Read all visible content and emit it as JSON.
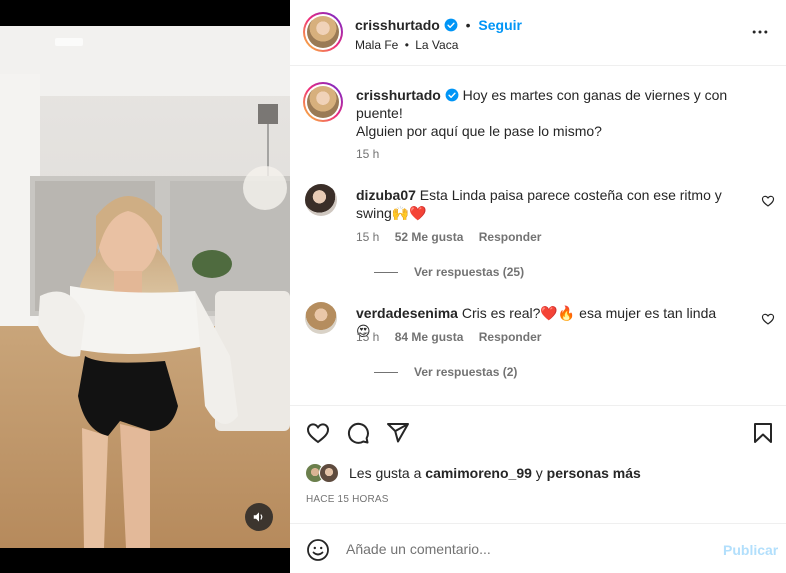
{
  "post": {
    "username": "crisshurtado",
    "follow_label": "Seguir",
    "audio_artist": "Mala Fe",
    "audio_title": "La Vaca",
    "audio_sep": "•",
    "header_sep": "•"
  },
  "caption": {
    "username": "crisshurtado",
    "line1": "Hoy es martes con ganas de viernes y con",
    "line2": "puente!",
    "line3": "Alguien por aquí que le pase lo mismo?",
    "time": "15 h"
  },
  "comments": [
    {
      "username": "dizuba07",
      "text_line1": "Esta Linda paisa parece costeña con ese ritmo y",
      "text_line2": "swing🙌❤️",
      "time": "15 h",
      "likes": "52 Me gusta",
      "reply_label": "Responder",
      "view_replies": "Ver respuestas (25)"
    },
    {
      "username": "verdadesenima",
      "text_line1": "Cris es real?❤️🔥 esa mujer es tan linda 😍",
      "time": "15 h",
      "likes": "84 Me gusta",
      "reply_label": "Responder",
      "view_replies": "Ver respuestas (2)"
    }
  ],
  "likes": {
    "prefix": "Les gusta a",
    "user": "camimoreno_99",
    "conj": "y",
    "others": "personas más"
  },
  "posted_ago": "HACE 15 HORAS",
  "add_comment": {
    "placeholder": "Añade un comentario...",
    "publish_label": "Publicar"
  },
  "icons": {
    "verified": "verified-badge-icon",
    "more": "more-options-icon",
    "like": "heart-icon",
    "comment": "comment-icon",
    "share": "share-icon",
    "save": "bookmark-icon",
    "emoji": "emoji-icon",
    "mute": "speaker-icon"
  },
  "colors": {
    "accent": "#0095f6",
    "publish_disabled": "#b2dffc",
    "secondary_text": "#737373"
  }
}
